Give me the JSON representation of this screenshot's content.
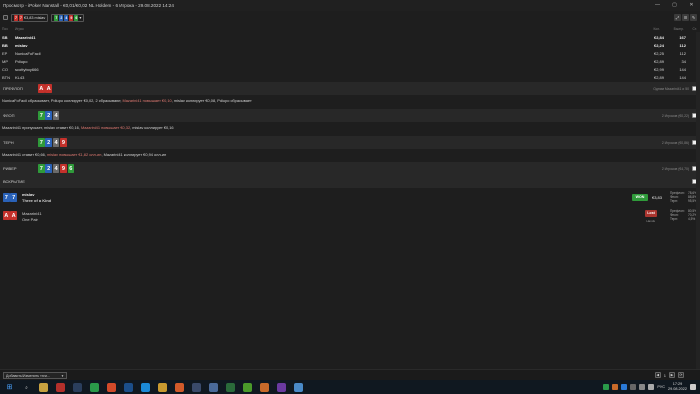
{
  "window": {
    "title": "Просмотр - iPoker Nanstall - €0,01/€0,02 NL Holdem - 6 Игрока - 29.08.2022 14:24",
    "controls": [
      "—",
      "▢",
      "✕"
    ]
  },
  "toolbar": {
    "chip_cards": [
      "7",
      "7"
    ],
    "chip_text": "€3,83 mislav",
    "board_cards": [
      "7",
      "2",
      "4",
      "9",
      "6"
    ],
    "expand": "▾",
    "icons": [
      "⤢",
      "☰",
      "✎"
    ]
  },
  "table_header": {
    "pos": "Поз",
    "name": "Игрок",
    "stack": "Кол.",
    "value": "Выигр.",
    "extra": "Ст."
  },
  "players": [
    {
      "pos": "SB",
      "name": "Mazarini41",
      "stack": "€2,84",
      "value": "167",
      "bold": true
    },
    {
      "pos": "BB",
      "name": "mislav",
      "stack": "€2,24",
      "value": "112",
      "bold": true
    },
    {
      "pos": "EP",
      "name": "NunicaFoFacil",
      "stack": "€2,25",
      "value": "112",
      "bold": false
    },
    {
      "pos": "MP",
      "name": "Pdiupo",
      "stack": "€2,89",
      "value": "34",
      "bold": false
    },
    {
      "pos": "CO",
      "name": "scottyboy666",
      "stack": "€2,99",
      "value": "144",
      "bold": false
    },
    {
      "pos": "BTN",
      "name": "KL43",
      "stack": "€2,89",
      "value": "144",
      "bold": false
    }
  ],
  "preflop": {
    "label": "ПРЕФЛОП",
    "cards": [
      "A",
      "A"
    ],
    "summary": "Одним Mazarini41 и 50",
    "actions": [
      {
        "t": "NunicaFoFacil сбрасывает, Pdiupo коллирует €0,02, 2 сбрасывают, ",
        "r": false
      },
      {
        "t": "Mazarini41 повышает €0,10",
        "r": true
      },
      {
        "t": ", mislav коллирует €0,08, Pdiupo сбрасывает",
        "r": false
      }
    ]
  },
  "flop": {
    "label": "ФЛОП",
    "cards": [
      "7",
      "2",
      "4"
    ],
    "summary": "2 Игроков (€0,22)",
    "actions": [
      {
        "t": "Mazarini41 пропускает, mislav ставит €0,16, ",
        "r": false
      },
      {
        "t": "Mazarini41 повышает €0,32",
        "r": true
      },
      {
        "t": ", mislav коллирует €0,16",
        "r": false
      }
    ]
  },
  "turn": {
    "label": "ТЕРН",
    "cards": [
      "7",
      "2",
      "4",
      "9"
    ],
    "summary": "2 Игроков (€0,86)",
    "actions": [
      {
        "t": "Mazarini41 ставит €0,66, ",
        "r": false
      },
      {
        "t": "mislav повышает €1,82 олл-ин",
        "r": true
      },
      {
        "t": ", Mazarini41 коллирует €0,94 олл-ин",
        "r": false
      }
    ]
  },
  "river": {
    "label": "РИВЕР",
    "cards": [
      "7",
      "2",
      "4",
      "9",
      "6"
    ],
    "summary": "2 Игроков (€4,70)"
  },
  "showdown": {
    "label": "ВСКРЫТИЕ"
  },
  "results": [
    {
      "cards": [
        "7",
        "7"
      ],
      "name": "mislav",
      "hand": "Three of a Kind",
      "badge": "WON",
      "amount": "€3,83",
      "stats": [
        [
          "Префлоп:",
          "78,6%"
        ],
        [
          "Флоп:",
          "88,8%"
        ],
        [
          "Терн:",
          "95,5%"
        ]
      ]
    },
    {
      "cards": [
        "A",
        "A"
      ],
      "name": "Mazarini41",
      "hand": "One Pair",
      "badge": "Lost",
      "badge_sub": "Hands",
      "stats": [
        [
          "Префлоп:",
          "80,5%"
        ],
        [
          "Флоп:",
          "70,2%"
        ],
        [
          "Терн:",
          "4,5%"
        ]
      ]
    }
  ],
  "bottom": {
    "dropdown": "Добавить/Изменить тэги...",
    "page": "1"
  },
  "taskbar": {
    "lang": "РУС",
    "time": "17:29",
    "date": "29.08.2022"
  }
}
